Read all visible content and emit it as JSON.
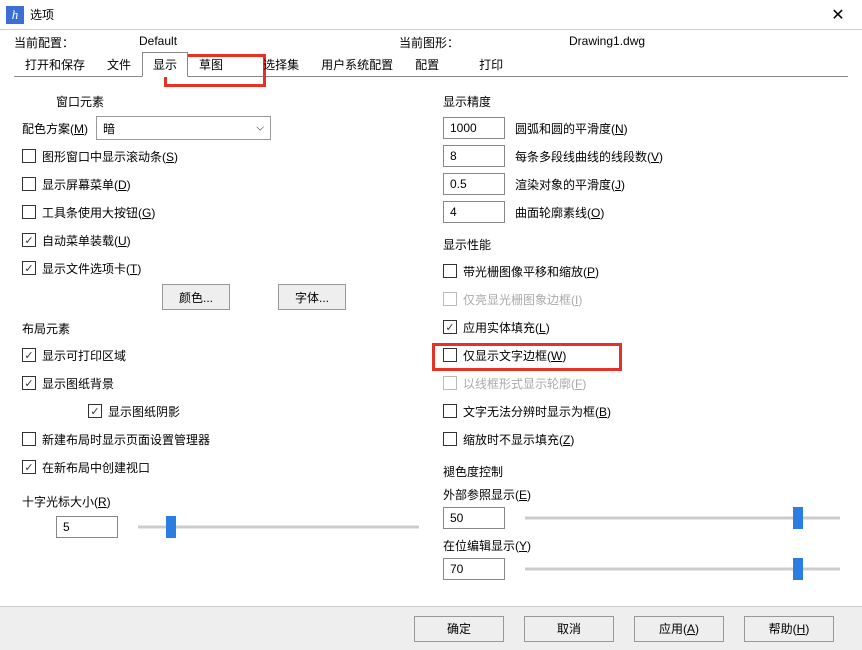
{
  "title": "选项",
  "info": {
    "currentConfigLabel": "当前配置：",
    "currentConfigValue": "Default",
    "currentDrawingLabel": "当前图形：",
    "currentDrawingValue": "Drawing1.dwg"
  },
  "tabs": [
    "打开和保存",
    "文件",
    "显示",
    "草图",
    "选择集",
    "用户系统配置",
    "配置",
    "打印"
  ],
  "left": {
    "windowElemTitle": "窗口元素",
    "colorSchemeLabel": "配色方案(M)",
    "colorSchemeValue": "暗",
    "scrollbars": "图形窗口中显示滚动条(S)",
    "screenMenu": "显示屏幕菜单(D)",
    "bigButtons": "工具条使用大按钮(G)",
    "autoMenu": "自动菜单装载(U)",
    "fileTabs": "显示文件选项卡(T)",
    "btnColor": "颜色...",
    "btnFont": "字体...",
    "layoutTitle": "布局元素",
    "printArea": "显示可打印区域",
    "paperBg": "显示图纸背景",
    "paperShadow": "显示图纸阴影",
    "newLayoutMgr": "新建布局时显示页面设置管理器",
    "newLayoutViewport": "在新布局中创建视口",
    "crosshairTitle": "十字光标大小(R)",
    "crosshairValue": "5"
  },
  "right": {
    "precisionTitle": "显示精度",
    "arcSmooth": {
      "val": "1000",
      "label": "圆弧和圆的平滑度(N)"
    },
    "polySegments": {
      "val": "8",
      "label": "每条多段线曲线的线段数(V)"
    },
    "renderSmooth": {
      "val": "0.5",
      "label": "渲染对象的平滑度(J)"
    },
    "isoline": {
      "val": "4",
      "label": "曲面轮廓素线(O)"
    },
    "perfTitle": "显示性能",
    "panZoomRaster": "带光栅图像平移和缩放(P)",
    "highlightRasterFrame": "仅亮显光栅图象边框(I)",
    "solidFill": "应用实体填充(L)",
    "textFrameOnly": "仅显示文字边框(W)",
    "wireframe": "以线框形式显示轮廓(F)",
    "textBox": "文字无法分辨时显示为框(B)",
    "noFillZoom": "缩放时不显示填充(Z)",
    "fadeTitle": "褪色度控制",
    "xrefLabel": "外部参照显示(E)",
    "xrefValue": "50",
    "inplaceLabel": "在位编辑显示(Y)",
    "inplaceValue": "70"
  },
  "footer": {
    "ok": "确定",
    "cancel": "取消",
    "apply": "应用(A)",
    "help": "帮助(H)"
  }
}
